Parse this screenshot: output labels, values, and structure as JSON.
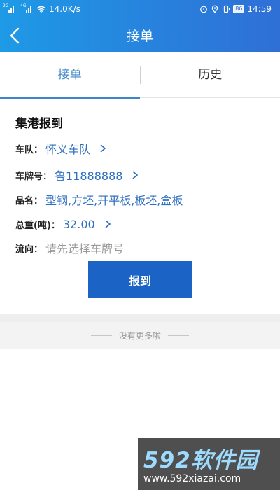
{
  "status_bar": {
    "net_tag_1": "2G",
    "net_tag_2": "4G",
    "speed": "14.0K/s",
    "battery": "86",
    "time": "14:59"
  },
  "nav": {
    "title": "接单"
  },
  "tabs": [
    {
      "label": "接单",
      "active": true
    },
    {
      "label": "历史",
      "active": false
    }
  ],
  "card": {
    "title": "集港报到",
    "fields": {
      "team": {
        "label": "车队：",
        "value": "怀义车队"
      },
      "plate": {
        "label": "车牌号：",
        "value": "鲁11888888"
      },
      "goods": {
        "label": "品名：",
        "value": "型钢,方坯,开平板,板坯,盒板"
      },
      "weight": {
        "label": "总重(吨)：",
        "value": "32.00"
      },
      "flow": {
        "label": "流向：",
        "placeholder": "请先选择车牌号"
      }
    },
    "submit_label": "报到"
  },
  "footer": {
    "no_more": "没有更多啦"
  },
  "watermark": {
    "brand": "592软件园",
    "url": "www.592xiazai.com"
  },
  "colors": {
    "header_start": "#1e9ae6",
    "header_end": "#2f6fd6",
    "accent": "#3a86c8",
    "button": "#1b63c4",
    "value": "#2f6fbf"
  }
}
